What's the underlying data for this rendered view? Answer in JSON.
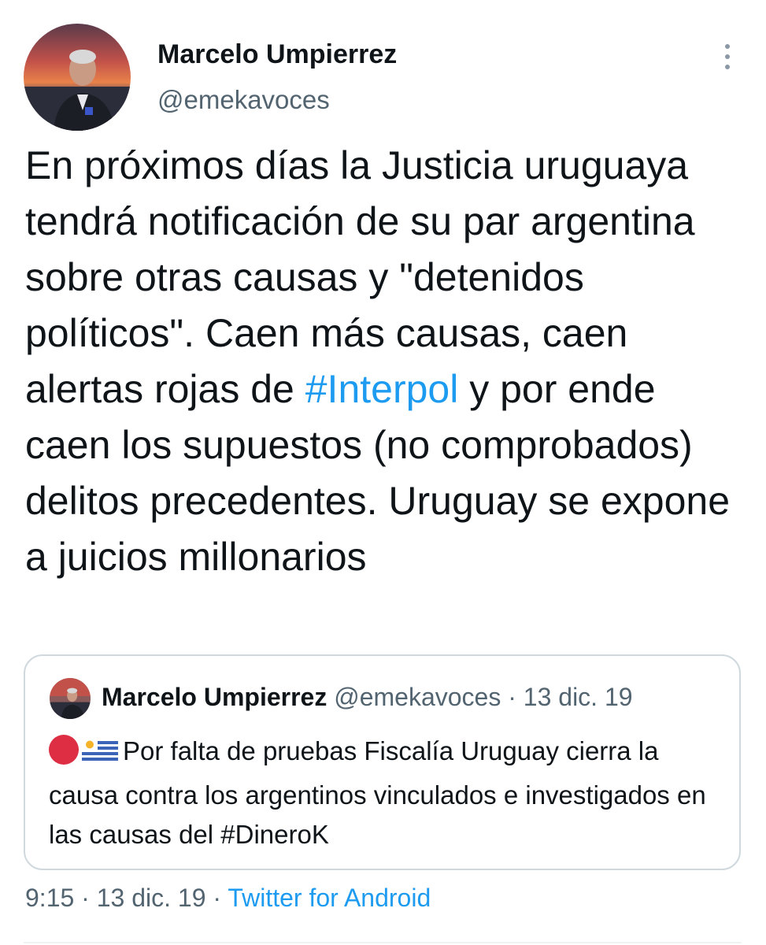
{
  "author": {
    "name": "Marcelo Umpierrez",
    "handle": "@emekavoces"
  },
  "tweet": {
    "text_before": "En próximos días la Justicia uruguaya tendrá notificación de su par argentina sobre otras causas y \"detenidos políticos\". Caen más causas, caen alertas rojas de ",
    "hashtag": "#Interpol",
    "text_after": " y por ende caen los supuestos (no comprobados) delitos precedentes. Uruguay se expone a juicios millonarios"
  },
  "quoted_tweet": {
    "author_name": "Marcelo Umpierrez",
    "handle": "@emekavoces",
    "separator": "·",
    "date": "13 dic. 19",
    "emojis": [
      "red-circle-icon",
      "uruguay-flag-icon"
    ],
    "text": "Por falta de pruebas Fiscalía Uruguay cierra la causa contra los argentinos vinculados e investigados en las causas del #DineroK"
  },
  "footer": {
    "time": "9:15",
    "separator": "·",
    "date": "13 dic. 19",
    "source": "Twitter for Android"
  },
  "colors": {
    "link": "#1d9bf0",
    "text": "#0f1419",
    "muted": "#536471",
    "border": "#cfd9de"
  },
  "icons": {
    "more": "more-vertical-icon"
  }
}
